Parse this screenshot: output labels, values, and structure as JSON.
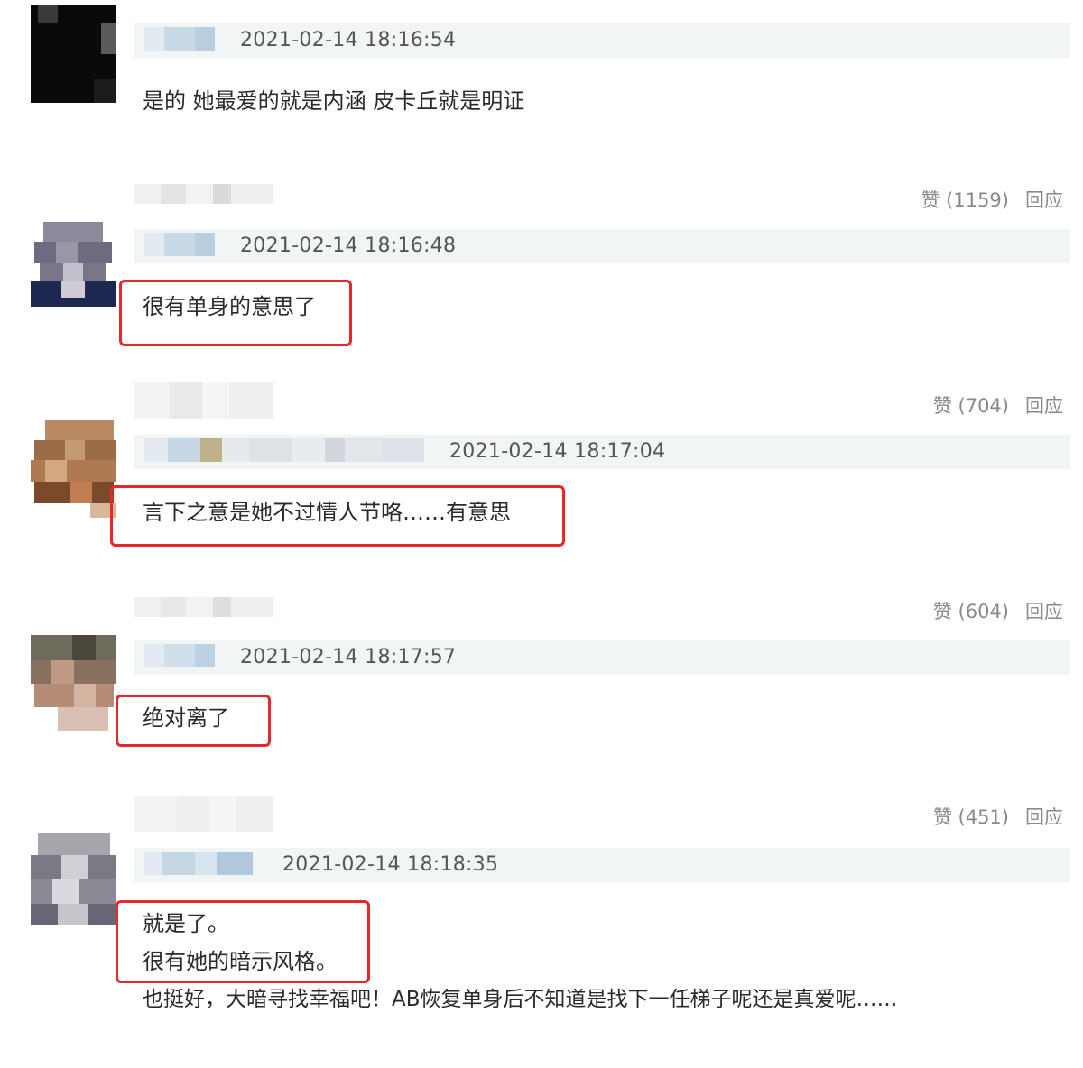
{
  "comments": [
    {
      "time": "2021-02-14 18:16:54",
      "lines": [
        "是的 她最爱的就是内涵 皮卡丘就是明证"
      ],
      "likes_label": "赞 (1159)",
      "reply_label": "回应"
    },
    {
      "time": "2021-02-14 18:16:48",
      "lines": [
        "很有单身的意思了"
      ],
      "likes_label": "赞 (704)",
      "reply_label": "回应"
    },
    {
      "time": "2021-02-14 18:17:04",
      "lines": [
        "言下之意是她不过情人节咯……有意思"
      ],
      "likes_label": "赞 (604)",
      "reply_label": "回应"
    },
    {
      "time": "2021-02-14 18:17:57",
      "lines": [
        "绝对离了"
      ],
      "likes_label": "赞 (451)",
      "reply_label": "回应"
    },
    {
      "time": "2021-02-14 18:18:35",
      "lines": [
        "就是了。",
        "很有她的暗示风格。"
      ],
      "extra": "也挺好，大暗寻找幸福吧！AB恢复单身后不知道是找下一任梯子呢还是真爱呢……"
    }
  ],
  "colors": {
    "highlight": "#e8262b",
    "header_bg": "#f1f5f6",
    "text": "#2a2a2a",
    "muted": "#8a8a8a"
  }
}
